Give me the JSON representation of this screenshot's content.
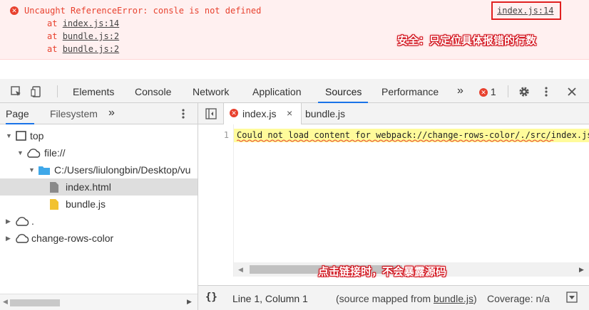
{
  "console_error": {
    "message": "Uncaught ReferenceError: consle is not defined",
    "source_link": "index.js:14",
    "stack": [
      {
        "prefix": "at ",
        "link": "index.js:14"
      },
      {
        "prefix": "at ",
        "link": "bundle.js:2"
      },
      {
        "prefix": "at ",
        "link": "bundle.js:2"
      }
    ],
    "annotation": "安全：只定位具体报错的行数"
  },
  "devtools": {
    "tabs": [
      "Elements",
      "Console",
      "Network",
      "Application",
      "Sources",
      "Performance"
    ],
    "active_tab": "Sources",
    "more_tabs": "»",
    "error_count": "1",
    "settings_icon": "gear-icon",
    "menu_icon": "kebab-icon",
    "close_icon": "close-icon"
  },
  "navigator": {
    "tabs": [
      "Page",
      "Filesystem"
    ],
    "more": "»",
    "tree": {
      "top": "top",
      "file_origin": "file://",
      "folder": "C:/Users/liulongbin/Desktop/vu",
      "files": [
        "index.html",
        "bundle.js"
      ],
      "dot_origin": ".",
      "webpack_origin": "change-rows-color"
    }
  },
  "editor": {
    "tabs": [
      {
        "label": "index.js",
        "close": "×",
        "has_error": true
      },
      {
        "label": "bundle.js"
      }
    ],
    "line_number": "1",
    "line_content": "Could not load content for webpack://change-rows-color/./src/index.js",
    "annotation": "点击链接时，不会暴露源码"
  },
  "status": {
    "pretty_print": "{}",
    "position": "Line 1, Column 1",
    "mapped_prefix": "(source mapped from ",
    "mapped_link": "bundle.js",
    "mapped_suffix": ")",
    "coverage": "Coverage: n/a"
  },
  "colors": {
    "error_red": "#e8412e",
    "annotation_red": "#d2101a",
    "active_tab_blue": "#1a73e8",
    "highlight_yellow": "#fffb9b"
  }
}
